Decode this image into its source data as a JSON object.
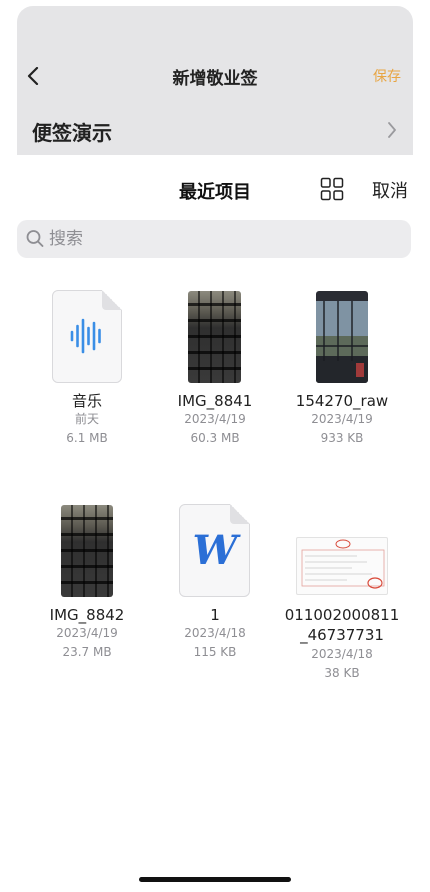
{
  "background_page": {
    "title": "新增敬业签",
    "save_label": "保存",
    "row_label": "便签演示"
  },
  "picker": {
    "title": "最近项目",
    "cancel_label": "取消",
    "search": {
      "placeholder": "搜索",
      "value": ""
    }
  },
  "files": [
    {
      "name": "音乐",
      "date": "前天",
      "size": "6.1 MB",
      "kind": "audio"
    },
    {
      "name": "IMG_8841",
      "date": "2023/4/19",
      "size": "60.3 MB",
      "kind": "photo-keyboard"
    },
    {
      "name": "154270_raw",
      "date": "2023/4/19",
      "size": "933 KB",
      "kind": "photo-window"
    },
    {
      "name": "IMG_8842",
      "date": "2023/4/19",
      "size": "23.7 MB",
      "kind": "photo-keyboard"
    },
    {
      "name": "1",
      "date": "2023/4/18",
      "size": "115 KB",
      "kind": "word",
      "badge": "W"
    },
    {
      "name": "011002000811",
      "name_line2": "_46737731",
      "date": "2023/4/18",
      "size": "38 KB",
      "kind": "invoice"
    }
  ],
  "colors": {
    "accent_save": "#e8a543",
    "audio_blue": "#3a8ee6",
    "word_blue": "#2b6fd6",
    "invoice_red": "#d94a3a"
  },
  "icons": {
    "back": "chevron-left-icon",
    "row": "chevron-right-icon",
    "view_toggle": "grid-view-icon",
    "search": "search-icon"
  }
}
